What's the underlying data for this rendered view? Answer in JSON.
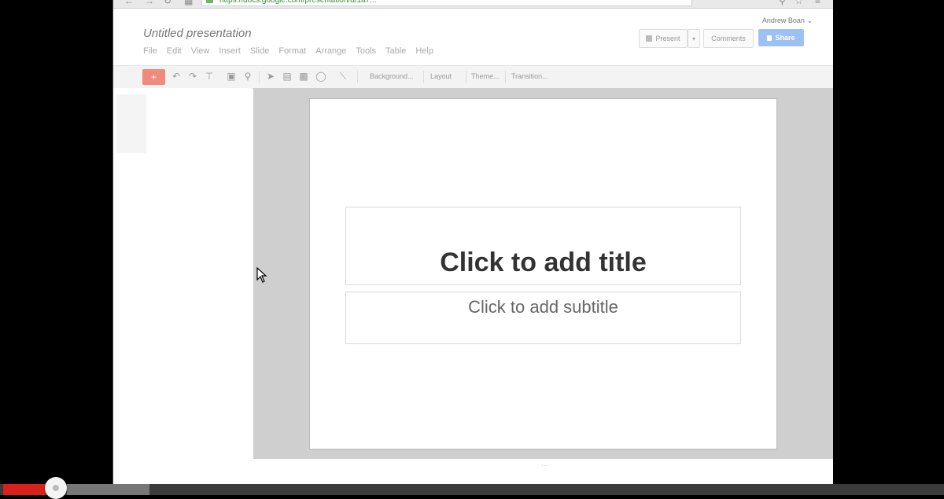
{
  "browser": {
    "url": "https://docs.google.com/presentation/d/1a7..."
  },
  "doc": {
    "title": "Untitled presentation",
    "menu": [
      "File",
      "Edit",
      "View",
      "Insert",
      "Slide",
      "Format",
      "Arrange",
      "Tools",
      "Table",
      "Help"
    ]
  },
  "header": {
    "user": "Andrew Boan",
    "present_label": "Present",
    "comments_label": "Comments",
    "share_label": "Share"
  },
  "toolbar": {
    "new_slide": "+",
    "background_label": "Background...",
    "layout_label": "Layout",
    "theme_label": "Theme...",
    "transition_label": "Transition..."
  },
  "slide": {
    "title_placeholder": "Click to add title",
    "subtitle_placeholder": "Click to add subtitle"
  },
  "player": {
    "played_fraction": 0.05,
    "buffered_fraction": 0.16
  }
}
